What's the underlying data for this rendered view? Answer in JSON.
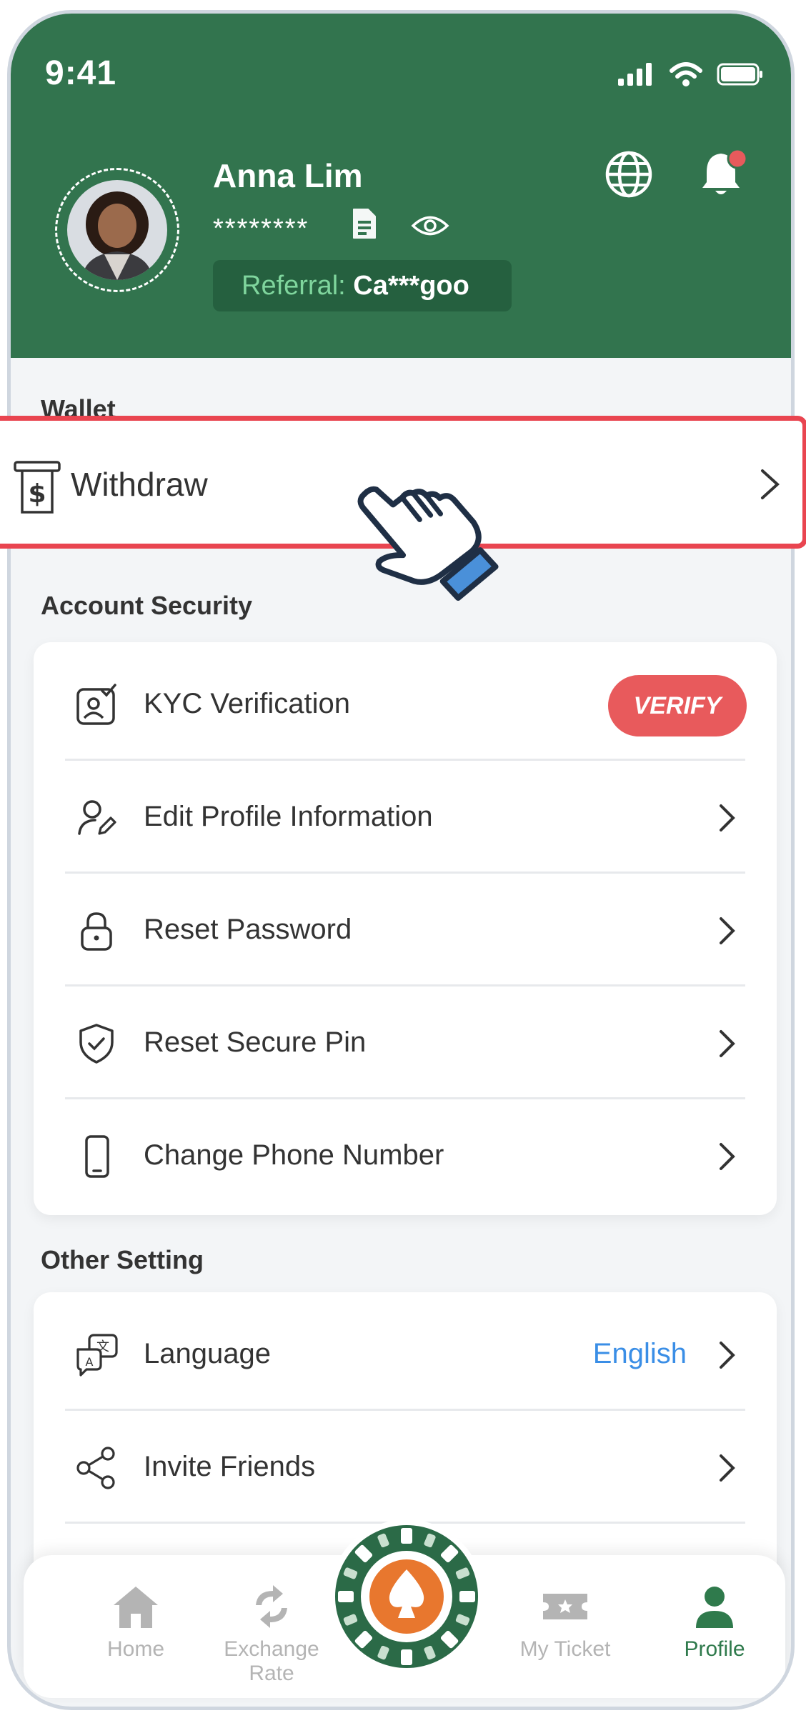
{
  "status_bar": {
    "time": "9:41"
  },
  "profile": {
    "name": "Anna Lim",
    "masked_id": "********",
    "referral_label": "Referral: ",
    "referral_value": "Ca***goo"
  },
  "wallet": {
    "title": "Wallet",
    "withdraw_label": "Withdraw"
  },
  "account_security": {
    "title": "Account Security",
    "items": [
      {
        "label": "KYC Verification",
        "badge": "VERIFY",
        "icon": "kyc-icon"
      },
      {
        "label": "Edit Profile Information",
        "icon": "user-edit-icon"
      },
      {
        "label": "Reset Password",
        "icon": "lock-icon"
      },
      {
        "label": "Reset Secure Pin",
        "icon": "shield-check-icon"
      },
      {
        "label": "Change Phone Number",
        "icon": "phone-icon"
      }
    ]
  },
  "other_setting": {
    "title": "Other Setting",
    "items": [
      {
        "label": "Language",
        "value": "English",
        "icon": "translate-icon"
      },
      {
        "label": "Invite Friends",
        "icon": "share-icon"
      }
    ]
  },
  "bottom_nav": {
    "items": [
      {
        "label": "Home",
        "icon": "home-icon"
      },
      {
        "label": "Exchange Rate",
        "icon": "exchange-icon"
      },
      {
        "label": "My Ticket",
        "icon": "ticket-icon"
      },
      {
        "label": "Profile",
        "icon": "profile-icon",
        "active": true
      }
    ]
  },
  "colors": {
    "header_green": "#32744e",
    "accent_green": "#2f7a4c",
    "verify_red": "#e85a5c",
    "highlight_red": "#e94550",
    "link_blue": "#3a8ee6"
  }
}
